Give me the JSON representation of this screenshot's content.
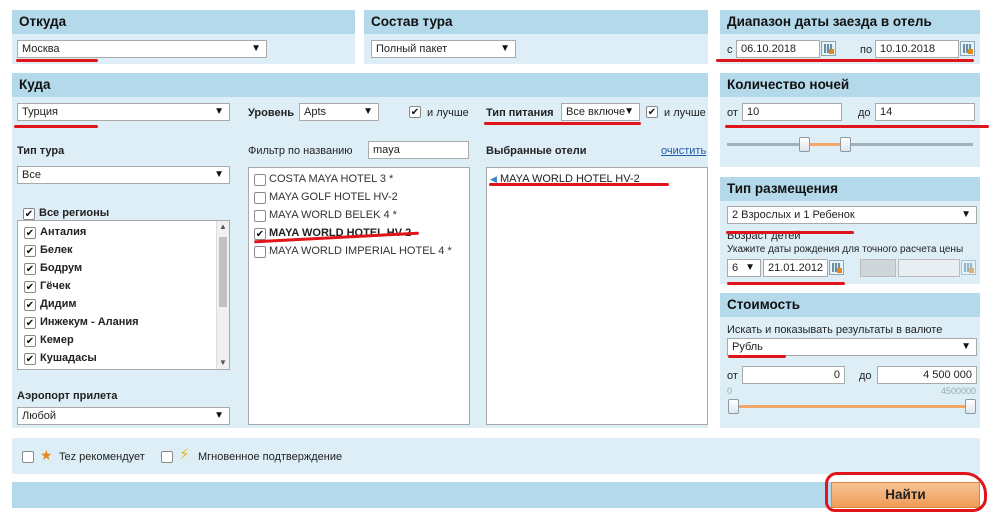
{
  "from": {
    "title": "Откуда",
    "city": "Москва"
  },
  "composition": {
    "title": "Состав тура",
    "value": "Полный пакет"
  },
  "dates": {
    "title": "Диапазон даты заезда в отель",
    "from_label": "с",
    "from_value": "06.10.2018",
    "to_label": "по",
    "to_value": "10.10.2018"
  },
  "destination": {
    "title": "Куда",
    "country": "Турция",
    "level_label": "Уровень",
    "level_value": "Apts",
    "better_label": "и лучше",
    "meal_label": "Тип питания",
    "meal_value": "Все включе",
    "meal_better_label": "и лучше",
    "tour_type_label": "Тип тура",
    "tour_type_value": "Все",
    "filter_label": "Фильтр по названию",
    "filter_value": "maya",
    "selected_label": "Выбранные отели",
    "clear_label": "очистить",
    "all_regions_label": "Все регионы",
    "regions": [
      "Анталия",
      "Белек",
      "Бодрум",
      "Гёчек",
      "Дидим",
      "Инжекум - Алания",
      "Кемер",
      "Кушадасы"
    ],
    "airport_label": "Аэропорт прилета",
    "airport_value": "Любой",
    "hotels": [
      {
        "name": "COSTA MAYA HOTEL 3 *",
        "checked": false
      },
      {
        "name": "MAYA GOLF HOTEL HV-2",
        "checked": false
      },
      {
        "name": "MAYA WORLD BELEK 4 *",
        "checked": false
      },
      {
        "name": "MAYA WORLD HOTEL HV-2",
        "checked": true
      },
      {
        "name": "MAYA WORLD IMPERIAL HOTEL 4 *",
        "checked": false
      }
    ],
    "selected_hotels": [
      "MAYA WORLD HOTEL HV-2"
    ]
  },
  "nights": {
    "title": "Количество ночей",
    "from_label": "от",
    "from_value": "10",
    "to_label": "до",
    "to_value": "14"
  },
  "accommodation": {
    "title": "Тип размещения",
    "value": "2 Взрослых и 1 Ребенок",
    "children_age_label": "Возраст детей",
    "hint": "Укажите даты рождения для точного расчета цены",
    "child_age": "6",
    "child_birth": "21.01.2012"
  },
  "price": {
    "title": "Стоимость",
    "currency_label": "Искать и показывать результаты в валюте",
    "currency": "Рубль",
    "from_label": "от",
    "from_value": "0",
    "to_label": "до",
    "to_value": "4 500 000",
    "scale_min": "0",
    "scale_max": "4500000"
  },
  "options": {
    "recommended": "Tez рекомендует",
    "instant": "Мгновенное подтверждение"
  },
  "search_button": "Найти",
  "accent": {
    "header": "#b3d9ea",
    "panel": "#ddeef7",
    "button": "#f1a56a",
    "underline": "#e0141a"
  }
}
